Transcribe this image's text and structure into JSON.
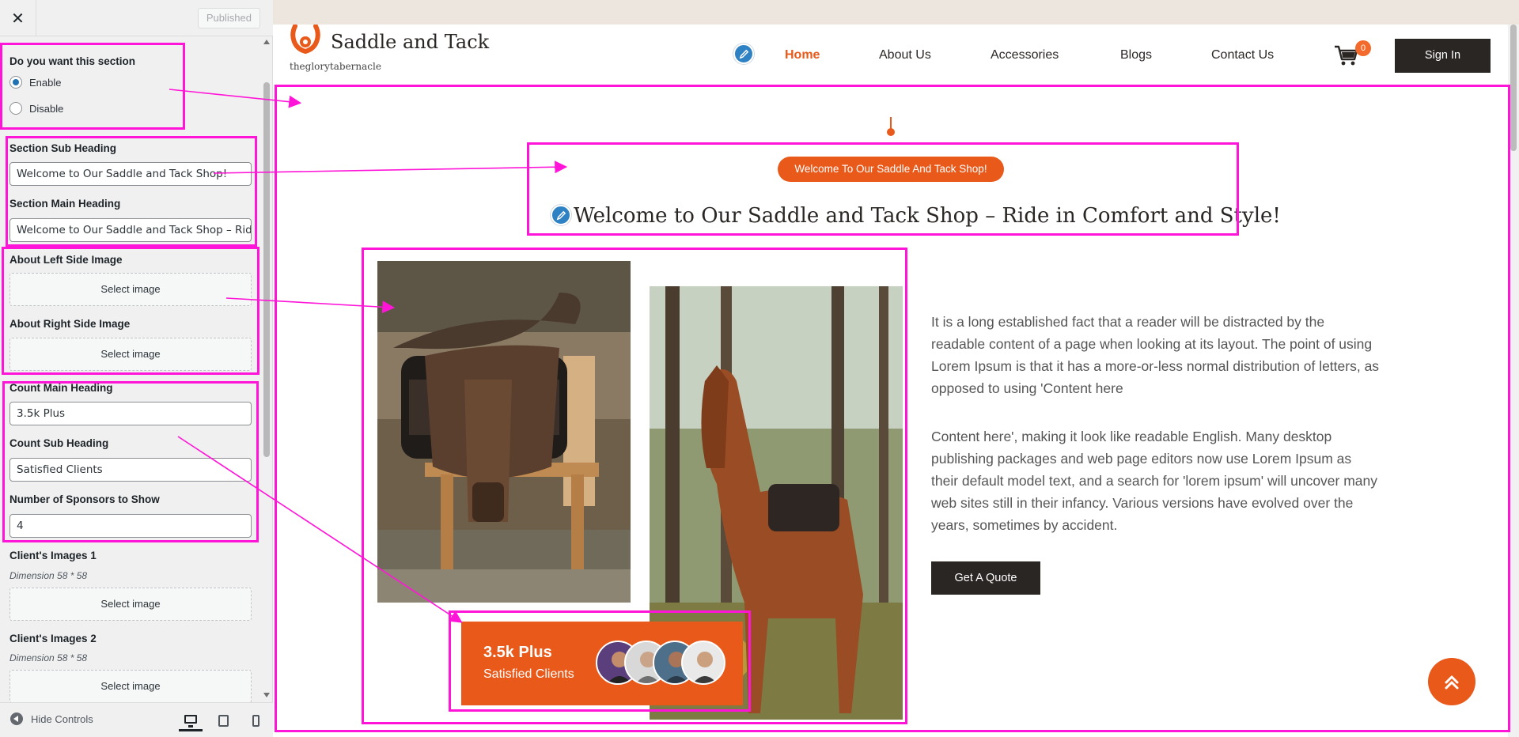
{
  "customizer": {
    "close_icon": "close-icon",
    "published_label": "Published",
    "section_toggle": {
      "label": "Do you want this section",
      "options": [
        "Enable",
        "Disable"
      ],
      "selected": "Enable"
    },
    "sub_heading": {
      "label": "Section Sub Heading",
      "value": "Welcome to Our Saddle and Tack Shop!"
    },
    "main_heading": {
      "label": "Section Main Heading",
      "value": "Welcome to Our Saddle and Tack Shop – Ride"
    },
    "left_image": {
      "label": "About Left Side Image",
      "button": "Select image"
    },
    "right_image": {
      "label": "About Right Side Image",
      "button": "Select image"
    },
    "count_main": {
      "label": "Count Main Heading",
      "value": "3.5k Plus"
    },
    "count_sub": {
      "label": "Count Sub Heading",
      "value": "Satisfied Clients"
    },
    "sponsors": {
      "label": "Number of Sponsors to Show",
      "value": "4"
    },
    "client_image_1": {
      "label": "Client's Images 1",
      "desc": "Dimension 58 * 58",
      "button": "Select image"
    },
    "client_image_2": {
      "label": "Client's Images 2",
      "desc": "Dimension 58 * 58",
      "button": "Select image"
    },
    "footer": {
      "hide_controls": "Hide Controls",
      "devices": [
        "desktop-icon",
        "tablet-icon",
        "mobile-icon"
      ]
    }
  },
  "site": {
    "brand": "Saddle and Tack",
    "tagline": "theglorytabernacle",
    "nav": [
      "Home",
      "About Us",
      "Accessories",
      "Blogs",
      "Contact Us"
    ],
    "active_nav": "Home",
    "cart_count": "0",
    "signin": "Sign In",
    "about": {
      "pill": "Welcome To Our Saddle And Tack Shop!",
      "heading": "Welcome to Our Saddle and Tack Shop – Ride in Comfort and Style!",
      "paragraph_1": "It is a long established fact that a reader will be distracted by the readable content of a page when looking at its layout. The point of using Lorem Ipsum is that it has a more-or-less normal distribution of letters, as opposed to using 'Content here",
      "paragraph_2": "Content here', making it look like readable English. Many desktop publishing packages and web page editors now use Lorem Ipsum as their default model text, and a search for 'lorem ipsum' will uncover many web sites still in their infancy. Various versions have evolved over the years, sometimes by accident.",
      "quote_button": "Get A Quote",
      "count_main": "3.5k Plus",
      "count_sub": "Satisfied Clients"
    }
  },
  "colors": {
    "accent": "#e8591a",
    "dark": "#2a2624",
    "annotation": "#ff14d8",
    "topbar": "#ede6df",
    "edit_blue": "#2e82c3"
  }
}
